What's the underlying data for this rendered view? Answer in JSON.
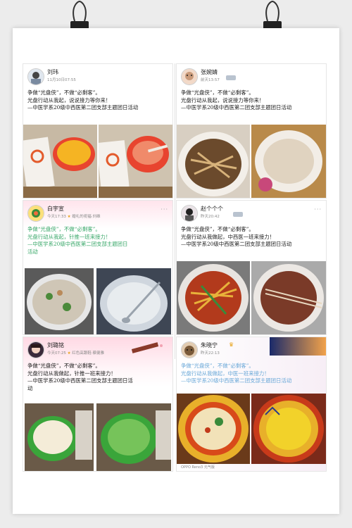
{
  "cards": [
    {
      "name": "刘玮",
      "meta": "11月10日07:55",
      "lines": [
        "争做“光盘侠”，不做“必剩客”。",
        "光盘行动从我起，说说接力等你来！",
        "—中医学系20级中西医第二团支部主题团日活动"
      ]
    },
    {
      "name": "张婉婧",
      "meta": "前天13:57",
      "lines": [
        "争做“光盘侠”，不做“必剩客”。",
        "光盘行动从我起，说说接力等你来！",
        "—中医学系20级中西医第二团支部主题团日活动"
      ]
    },
    {
      "name": "白宇宣",
      "meta": "今天17:33",
      "badge": "婚礼的祝福·刘维",
      "lines": [
        "争做“光盘侠”，不做“必剩客”。",
        "光盘行动从我起，针推一班来接力！",
        "—中医学系20级中西医第二团支部主题团日",
        "活动"
      ]
    },
    {
      "name": "赵个个个",
      "meta": "昨天20:42",
      "lines": [
        "争做“光盘侠”，不做“必剩客”。",
        "光盘行动从我做起，中西医一班来接力！",
        "—中医学系20级中西医第二团支部主题团日活动"
      ]
    },
    {
      "name": "刘璐铭",
      "meta": "今天07:25",
      "badge": "红色高跟鞋·蔡健雅",
      "lines": [
        "争做“光盘侠”，不做“必剩客”。",
        "光盘行动从我做起，针推一班来接力！",
        "—中医学系20级中西医第二团支部主题团日活",
        "动"
      ]
    },
    {
      "name": "朱晓宁",
      "meta": "昨天22:13",
      "lines": [
        "争做“光盘侠”，不做“必剩客”。",
        "光盘行动从我做起，中医一班来接力！",
        "—中医学系20级中西医第二团支部主题团日活动"
      ],
      "footer": "OPPO Reno3 元气版"
    }
  ],
  "colors": {
    "green_text": "#3aa86a",
    "teal_text": "#1aa3a0",
    "light_blue_text": "#6aa8d8"
  }
}
